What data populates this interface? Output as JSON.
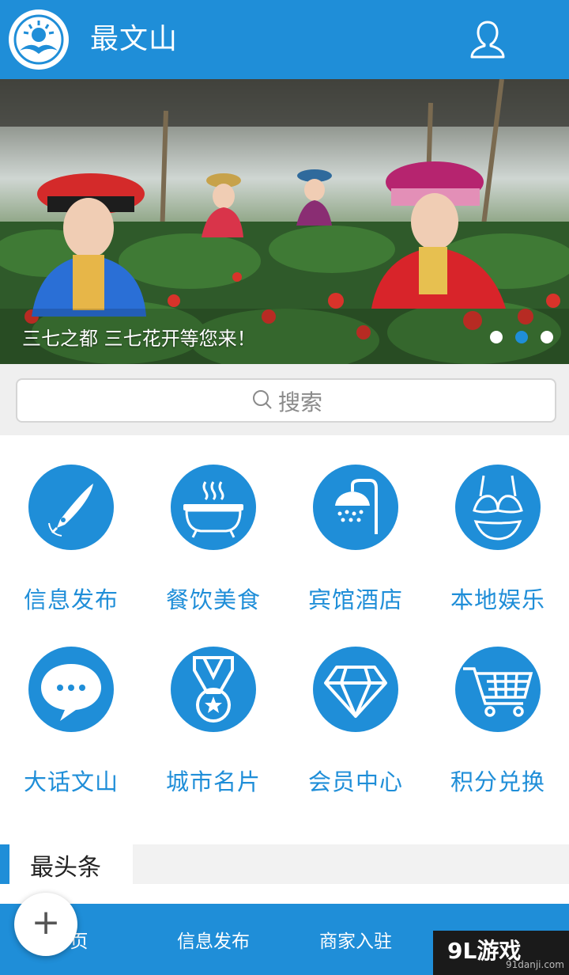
{
  "header": {
    "title": "最文山",
    "logo_icon": "sun-mountain-logo-icon",
    "user_icon": "user-icon",
    "color": "#1f8ed8"
  },
  "banner": {
    "caption": "三七之都 三七花开等您来！",
    "slide_count": 3,
    "active_slide": 2
  },
  "search": {
    "placeholder": "搜索",
    "icon": "search-icon"
  },
  "grid": [
    {
      "label": "信息发布",
      "icon": "pen-nib-icon"
    },
    {
      "label": "餐饮美食",
      "icon": "bathtub-icon"
    },
    {
      "label": "宾馆酒店",
      "icon": "shower-icon"
    },
    {
      "label": "本地娱乐",
      "icon": "bikini-icon"
    },
    {
      "label": "大话文山",
      "icon": "chat-bubble-icon"
    },
    {
      "label": "城市名片",
      "icon": "medal-icon"
    },
    {
      "label": "会员中心",
      "icon": "diamond-icon"
    },
    {
      "label": "积分兑换",
      "icon": "shopping-cart-icon"
    }
  ],
  "headlines": {
    "title": "最头条"
  },
  "bottom_nav": [
    {
      "label": "页"
    },
    {
      "label": "信息发布"
    },
    {
      "label": "商家入驻"
    }
  ],
  "fab": {
    "icon": "plus-icon"
  },
  "watermark": {
    "logo": "9L游戏",
    "site": "91danji.com"
  }
}
